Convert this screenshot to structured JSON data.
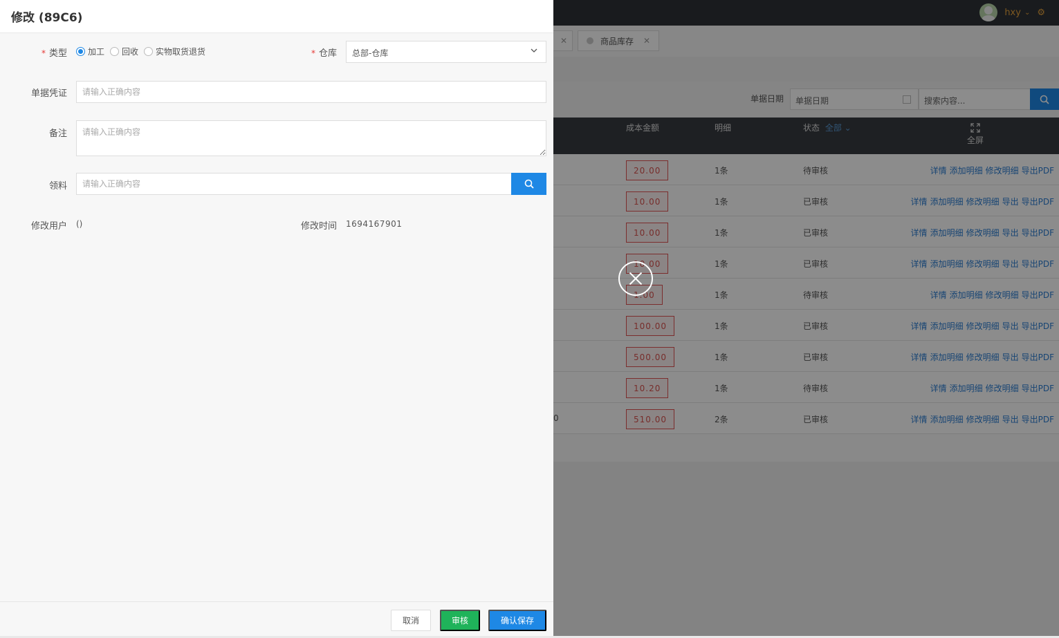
{
  "drawer": {
    "title": "修改 (89C6)",
    "type_label": "类型",
    "type_options": [
      "加工",
      "回收",
      "实物取货退货"
    ],
    "type_selected": "加工",
    "warehouse_label": "仓库",
    "warehouse_value": "总部-仓库",
    "voucher_label": "单据凭证",
    "voucher_placeholder": "请输入正确内容",
    "remark_label": "备注",
    "remark_placeholder": "请输入正确内容",
    "material_label": "领料",
    "material_placeholder": "请输入正确内容",
    "modifier_label": "修改用户",
    "modifier_value": "()",
    "modified_time_label": "修改时间",
    "modified_time_value": "1694167901",
    "cancel_label": "取消",
    "audit_label": "审核",
    "save_label": "确认保存"
  },
  "background": {
    "username": "hxy",
    "tabs": [
      "商品库存"
    ],
    "date_filter_label": "单据日期",
    "date_filter_placeholder": "单据日期",
    "search_placeholder": "搜索内容...",
    "columns": {
      "cost_amount": "成本金额",
      "detail": "明细",
      "status": "状态",
      "status_filter": "全部",
      "fullscreen": "全屏"
    },
    "rows": [
      {
        "amount": "20.00",
        "count": "1条",
        "status": "待审核",
        "ops": [
          "详情",
          "添加明细",
          "修改明细",
          "导出PDF"
        ]
      },
      {
        "amount": "10.00",
        "count": "1条",
        "status": "已审核",
        "ops": [
          "详情",
          "添加明细",
          "修改明细",
          "导出",
          "导出PDF"
        ]
      },
      {
        "amount": "10.00",
        "count": "1条",
        "status": "已审核",
        "ops": [
          "详情",
          "添加明细",
          "修改明细",
          "导出",
          "导出PDF"
        ]
      },
      {
        "amount": "10.00",
        "count": "1条",
        "status": "已审核",
        "ops": [
          "详情",
          "添加明细",
          "修改明细",
          "导出",
          "导出PDF"
        ]
      },
      {
        "amount": "1.00",
        "count": "1条",
        "status": "待审核",
        "ops": [
          "详情",
          "添加明细",
          "修改明细",
          "导出PDF"
        ]
      },
      {
        "amount": "100.00",
        "count": "1条",
        "status": "已审核",
        "ops": [
          "详情",
          "添加明细",
          "修改明细",
          "导出",
          "导出PDF"
        ]
      },
      {
        "amount": "500.00",
        "count": "1条",
        "status": "已审核",
        "ops": [
          "详情",
          "添加明细",
          "修改明细",
          "导出",
          "导出PDF"
        ]
      },
      {
        "amount": "10.20",
        "count": "1条",
        "status": "待审核",
        "ops": [
          "详情",
          "添加明细",
          "修改明细",
          "导出PDF"
        ]
      },
      {
        "amount": "510.00",
        "count": "2条",
        "status": "已审核",
        "ops": [
          "详情",
          "添加明细",
          "修改明细",
          "导出",
          "导出PDF"
        ],
        "lead": "0"
      }
    ]
  },
  "colors": {
    "primary": "#1e88e5",
    "success": "#1fb35a",
    "danger": "#e53935",
    "header_dark": "#2f3237"
  }
}
